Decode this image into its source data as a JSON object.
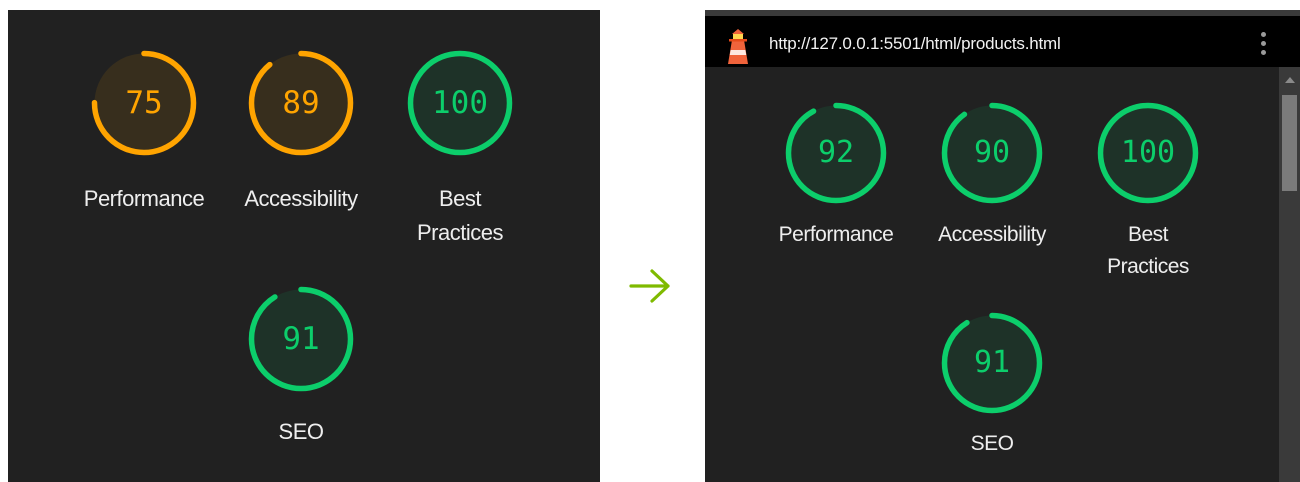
{
  "colors": {
    "panel_bg": "#212121",
    "pass": "#0cce6b",
    "average": "#ffa400",
    "arrow": "#7fba00"
  },
  "before": {
    "gauges": [
      {
        "id": "performance",
        "score": 75,
        "label_lines": [
          "Performance"
        ],
        "rating": "average"
      },
      {
        "id": "accessibility",
        "score": 89,
        "label_lines": [
          "Accessibility"
        ],
        "rating": "average"
      },
      {
        "id": "best-practices",
        "score": 100,
        "label_lines": [
          "Best",
          "Practices"
        ],
        "rating": "pass"
      },
      {
        "id": "seo",
        "score": 91,
        "label_lines": [
          "SEO"
        ],
        "rating": "pass"
      }
    ]
  },
  "transition": {
    "icon": "arrow-right-icon"
  },
  "after": {
    "header": {
      "icon": "lighthouse-icon",
      "url": "http://127.0.0.1:5501/html/products.html",
      "menu_icon": "kebab-menu-icon"
    },
    "gauges": [
      {
        "id": "performance",
        "score": 92,
        "label_lines": [
          "Performance"
        ],
        "rating": "pass"
      },
      {
        "id": "accessibility",
        "score": 90,
        "label_lines": [
          "Accessibility"
        ],
        "rating": "pass"
      },
      {
        "id": "best-practices",
        "score": 100,
        "label_lines": [
          "Best",
          "Practices"
        ],
        "rating": "pass"
      },
      {
        "id": "seo",
        "score": 91,
        "label_lines": [
          "SEO"
        ],
        "rating": "pass"
      }
    ]
  }
}
